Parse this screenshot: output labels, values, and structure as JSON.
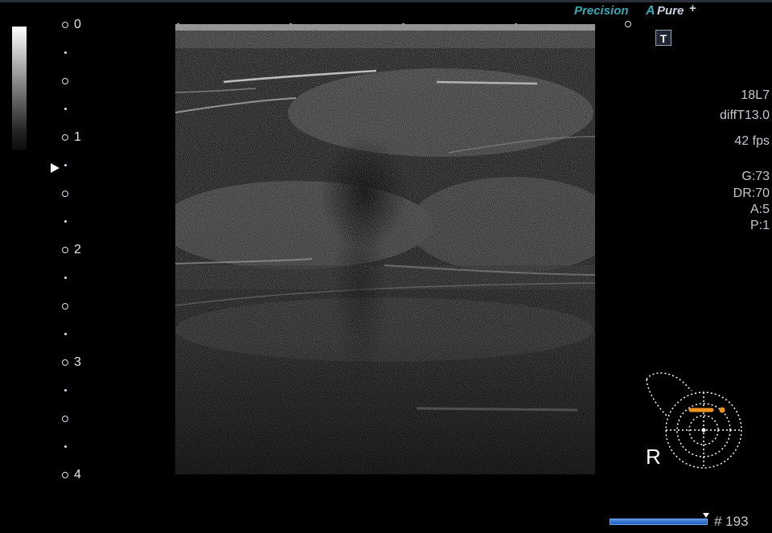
{
  "header": {
    "logo_precision": "Precision",
    "logo_apure_a": "A",
    "logo_apure": "Pure",
    "logo_plus": "+",
    "t_button": "T"
  },
  "depth_scale": {
    "labels": [
      "0",
      "1",
      "2",
      "3",
      "4"
    ],
    "focus_marker_icon": "triangle-right-icon"
  },
  "params": {
    "probe": "18L7",
    "mode": "diffT13.0",
    "fps": "42 fps",
    "gain": "G:73",
    "dynamic_range": "DR:70",
    "a": "A:5",
    "p": "P:1"
  },
  "body_mark": {
    "orientation": "R",
    "icon": "breast-body-mark-icon",
    "probe_color": "#f0961e"
  },
  "cine": {
    "frame_label": "# 193",
    "progress": 1.0
  },
  "colors": {
    "logo_accent": "#3aa8b5",
    "cine_bar": "#2f74d0",
    "background": "#000000"
  }
}
